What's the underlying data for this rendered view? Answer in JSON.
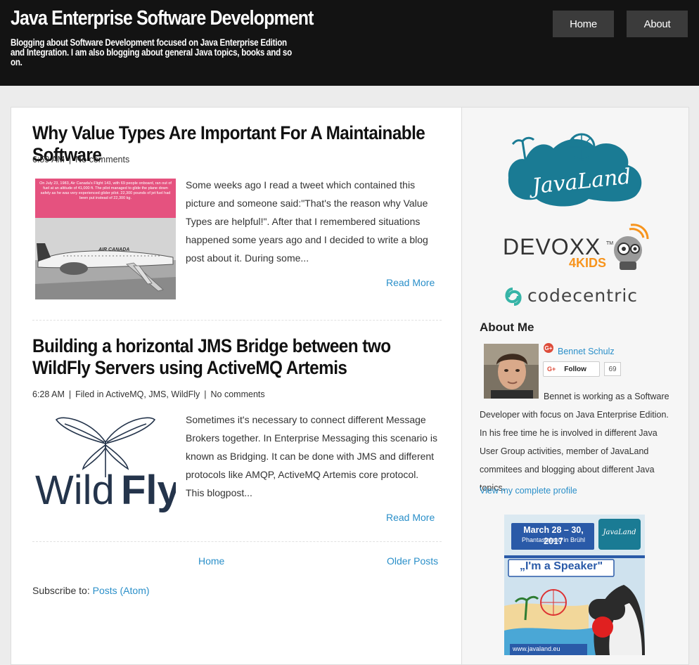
{
  "header": {
    "site_title": "Java Enterprise Software Development",
    "site_description": "Blogging about Software Development focused on Java Enterprise Edition and Integration. I am also blogging about general Java topics, books and so on.",
    "nav": [
      "Home",
      "About"
    ]
  },
  "posts": [
    {
      "title": "Why Value Types Are Important For A Maintainable Software",
      "time": "6:59 AM",
      "comments": "No comments",
      "thumb_caption": "On July 23, 1983, Air Canada's Flight 143, with 69 people onboard, ran out of fuel at an altitude of 41,000 ft. The pilot managed to glide the plane down safely as he was very experienced glider pilot. 22,300 pounds of jet fuel had been put instead of 22,300 kg.",
      "thumb_plane_label": "AIR CANADA",
      "excerpt": "Some weeks ago I read a tweet which contained this picture and someone said:\"That's the reason why Value Types are helpful!\". After that I remembered situations happened some years ago and I decided to write a blog post about it. During some...",
      "read_more": "Read More"
    },
    {
      "title": "Building a horizontal JMS Bridge between two WildFly Servers using ActiveMQ Artemis",
      "time": "6:28 AM",
      "filed_in_label": "Filed in",
      "labels": [
        "ActiveMQ",
        "JMS",
        "WildFly"
      ],
      "comments": "No comments",
      "thumb_text_light": "Wild",
      "thumb_text_bold": "Fly",
      "excerpt": "Sometimes it's necessary to connect different Message Brokers together. In Enterprise Messaging this scenario is known as Bridging. It can be done with JMS and different protocols like AMQP,  ActiveMQ Artemis core protocol. This blogpost...",
      "read_more": "Read More"
    }
  ],
  "pager": {
    "home": "Home",
    "older": "Older Posts"
  },
  "subscribe": {
    "label": "Subscribe to: ",
    "link": "Posts (Atom)"
  },
  "sidebar": {
    "sponsors": {
      "javaland": "JavaLand",
      "devoxx": "DEVOXX",
      "devoxx_sub": "4KIDS",
      "devoxx_tm": "TM",
      "codecentric": "codecentric"
    },
    "about": {
      "heading": "About Me",
      "name": "Bennet Schulz",
      "gplus": "G+",
      "follow": "Follow",
      "follow_count": "69",
      "bio": "Bennet is working as a Software Developer with focus on Java Enterprise Edition. In his free time he is involved in different Java User Group activities, member of JavaLand commitees and blogging about different Java topics.",
      "view_profile": "View my complete profile"
    },
    "banner": {
      "date": "March 28 – 30, 2017",
      "venue": "Phantasialand in Brühl",
      "speaker": "„I'm a Speaker\"",
      "url": "www.javaland.eu",
      "logo": "JavaLand"
    }
  },
  "colors": {
    "header_bg": "#131313",
    "link": "#2a8fc9",
    "javaland_teal": "#1a7b94",
    "banner_blue": "#2a5aa8"
  }
}
